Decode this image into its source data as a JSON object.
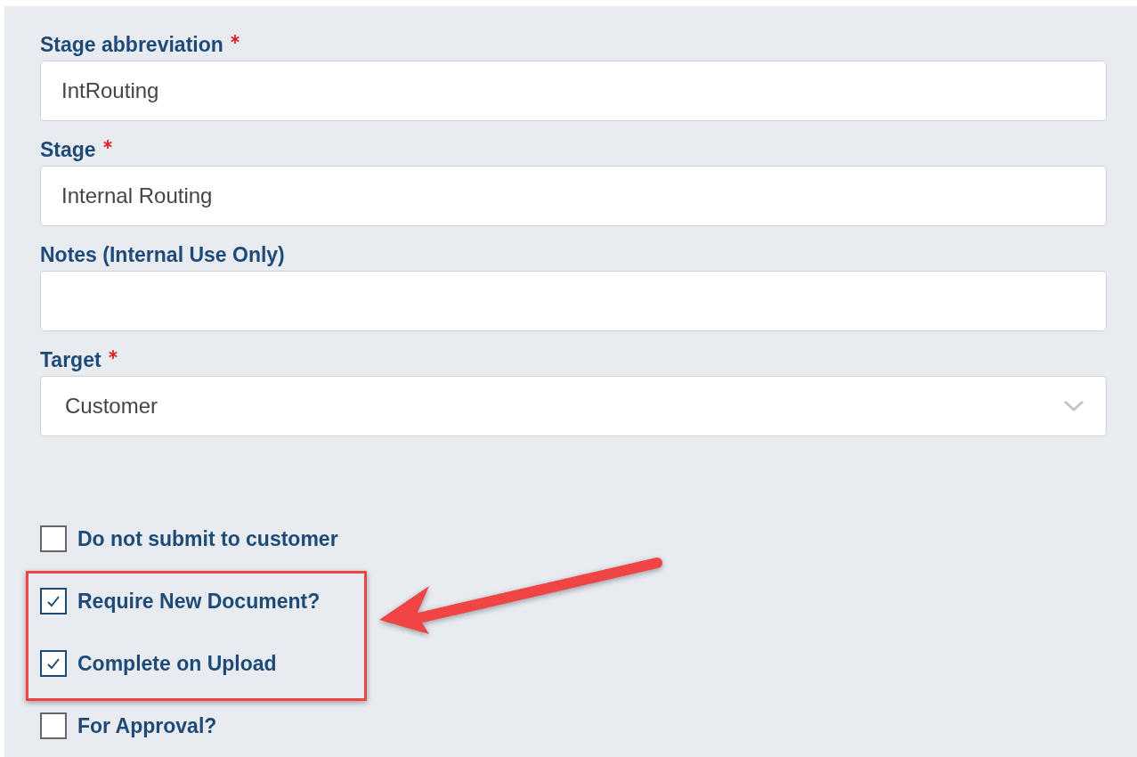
{
  "fields": [
    {
      "kind": "text",
      "label": "Stage abbreviation",
      "required": true,
      "value": "IntRouting"
    },
    {
      "kind": "text",
      "label": "Stage",
      "required": true,
      "value": "Internal Routing"
    },
    {
      "kind": "text",
      "label": "Notes (Internal Use Only)",
      "required": false
    },
    {
      "kind": "select",
      "label": "Target",
      "required": true,
      "value": "Customer"
    }
  ],
  "checkboxes": [
    {
      "label": "Do not submit to customer",
      "checked": false
    },
    {
      "label": "Require New Document?",
      "checked": true
    },
    {
      "label": "Complete on Upload",
      "checked": true
    },
    {
      "label": "For Approval?",
      "checked": false
    }
  ]
}
